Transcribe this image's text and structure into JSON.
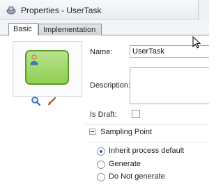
{
  "window": {
    "title": "Properties - UserTask"
  },
  "tabs": [
    {
      "label": "Basic",
      "active": true
    },
    {
      "label": "Implementation",
      "active": false
    }
  ],
  "preview": {
    "task_fill_color": "#9bd563",
    "task_border_color": "#5a9e2c",
    "icons": [
      "user-icon",
      "zoom-icon",
      "paint-brush-icon"
    ]
  },
  "form": {
    "name_label": "Name:",
    "name_value": "UserTask",
    "description_label": "Description:",
    "description_value": "",
    "is_draft_label": "Is Draft:",
    "is_draft_checked": false
  },
  "sampling": {
    "section_label": "Sampling Point",
    "options": [
      {
        "label": "Inherit process default",
        "selected": true
      },
      {
        "label": "Generate",
        "selected": false
      },
      {
        "label": "Do Not generate",
        "selected": false
      }
    ]
  }
}
